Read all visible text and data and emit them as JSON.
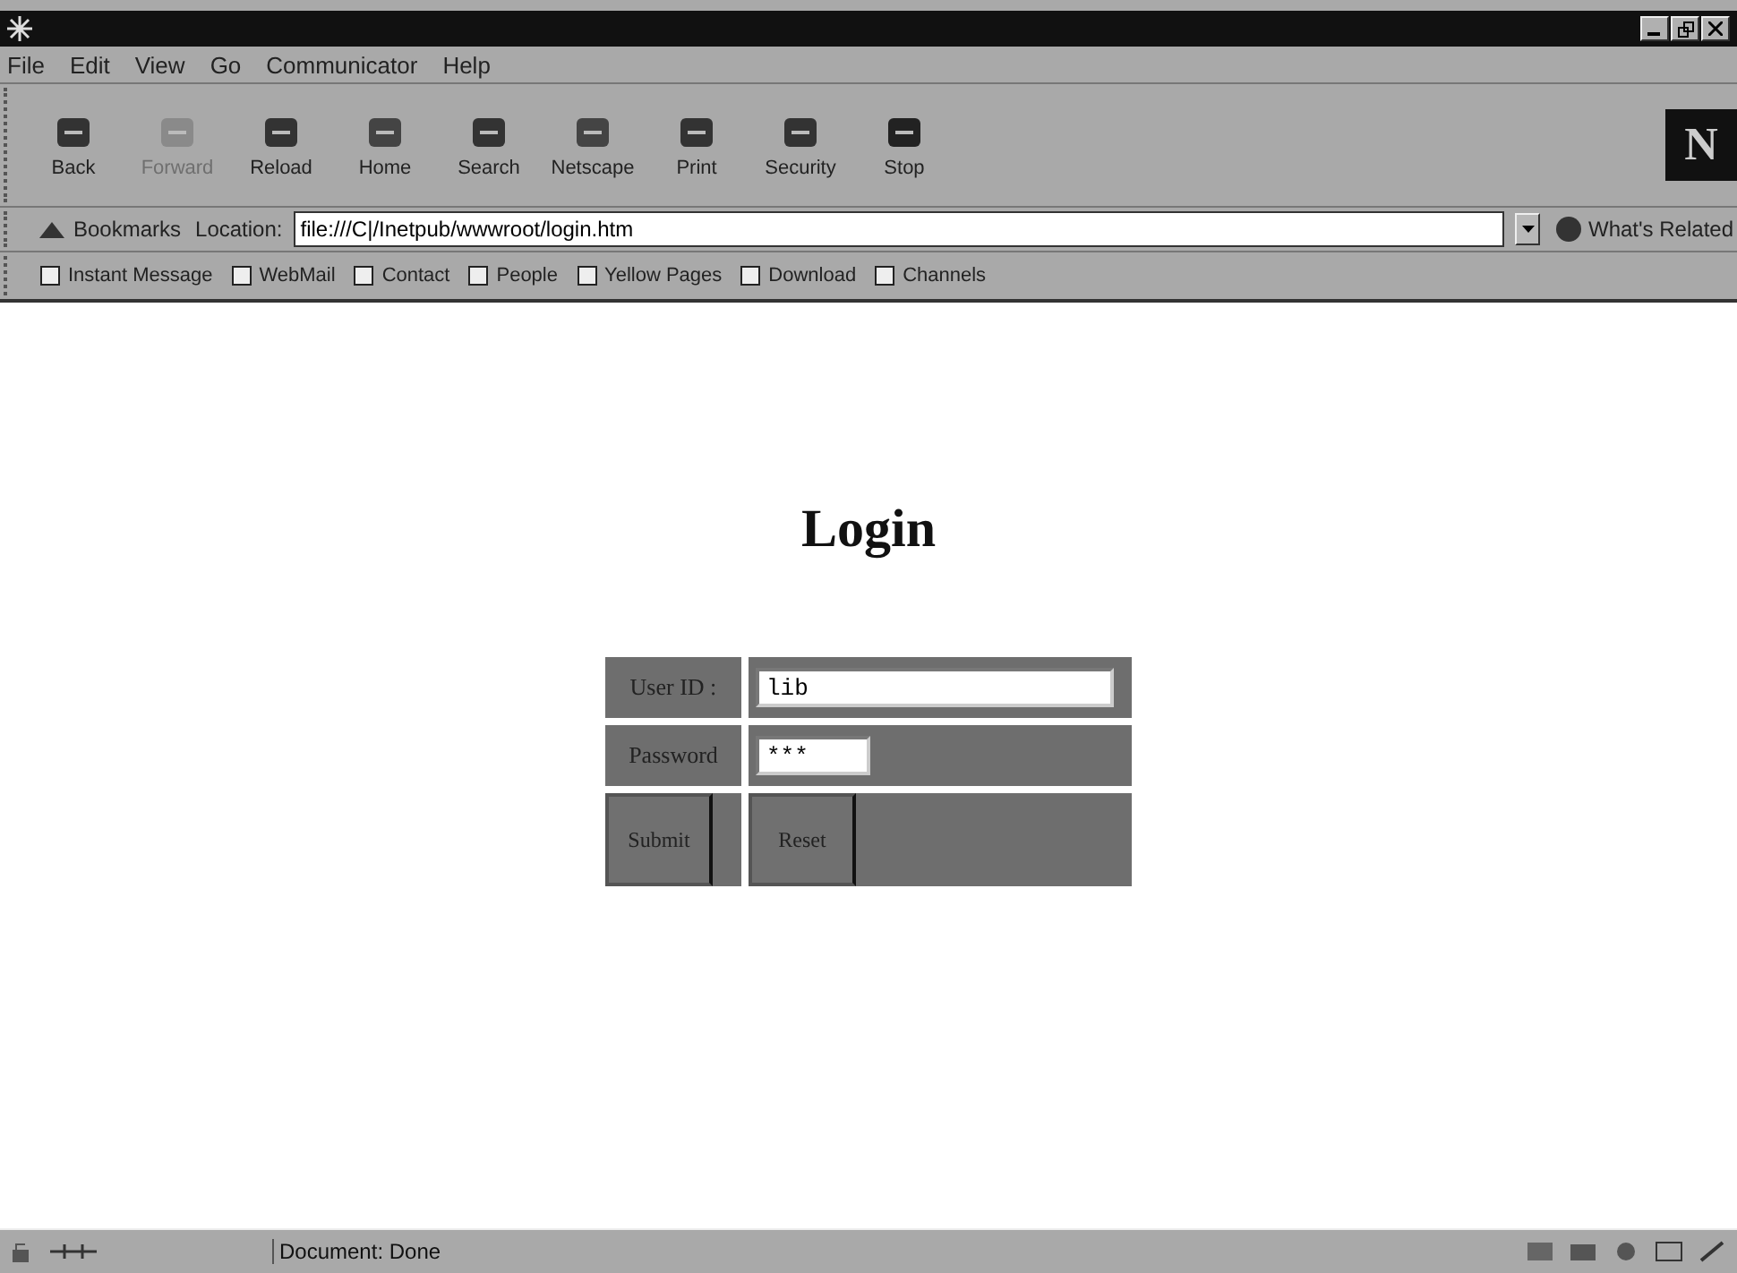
{
  "menu": [
    "File",
    "Edit",
    "View",
    "Go",
    "Communicator",
    "Help"
  ],
  "toolbar": [
    {
      "label": "Back",
      "disabled": false
    },
    {
      "label": "Forward",
      "disabled": true
    },
    {
      "label": "Reload",
      "disabled": false
    },
    {
      "label": "Home",
      "disabled": false
    },
    {
      "label": "Search",
      "disabled": false
    },
    {
      "label": "Netscape",
      "disabled": false
    },
    {
      "label": "Print",
      "disabled": false
    },
    {
      "label": "Security",
      "disabled": false
    },
    {
      "label": "Stop",
      "disabled": false
    }
  ],
  "logo": "N",
  "location_bar": {
    "bookmarks": "Bookmarks",
    "label": "Location:",
    "url": "file:///C|/Inetpub/wwwroot/login.htm",
    "related": "What's Related"
  },
  "personal_toolbar": [
    "Instant Message",
    "WebMail",
    "Contact",
    "People",
    "Yellow Pages",
    "Download",
    "Channels"
  ],
  "page": {
    "heading": "Login",
    "user_label": "User ID :",
    "user_value": "lib",
    "password_label": "Password",
    "password_value": "***",
    "buttons": [
      "Submit",
      "Reset"
    ]
  },
  "status_bar": {
    "text": "Document: Done"
  }
}
